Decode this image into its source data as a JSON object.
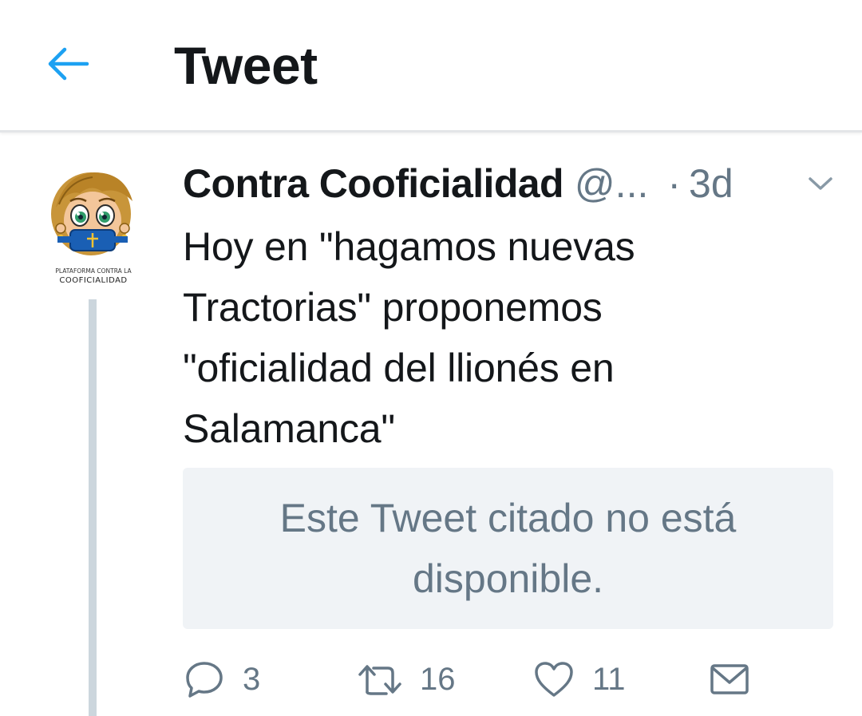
{
  "header": {
    "title": "Tweet",
    "back_icon": "arrow-left-icon",
    "accent_color": "#1da1f2"
  },
  "tweet": {
    "author_name": "Contra Cooficialidad",
    "author_handle": "@...",
    "separator": "·",
    "timestamp": "3d",
    "avatar": {
      "icon": "cartoon-girl-gagged-avatar",
      "caption_line1": "PLATAFORMA CONTRA LA",
      "caption_line2": "COOFICIALIDAD"
    },
    "text": "Hoy en \"hagamos nuevas\nTractorias\" proponemos\n\"oficialidad del llionés en\nSalamanca\"",
    "quoted_unavailable": "Este Tweet citado no está disponible.",
    "actions": {
      "reply_count": "3",
      "retweet_count": "16",
      "like_count": "11"
    }
  },
  "colors": {
    "muted_text": "#657786",
    "quote_background": "#f0f3f6",
    "thread_line": "#ccd6dd"
  }
}
